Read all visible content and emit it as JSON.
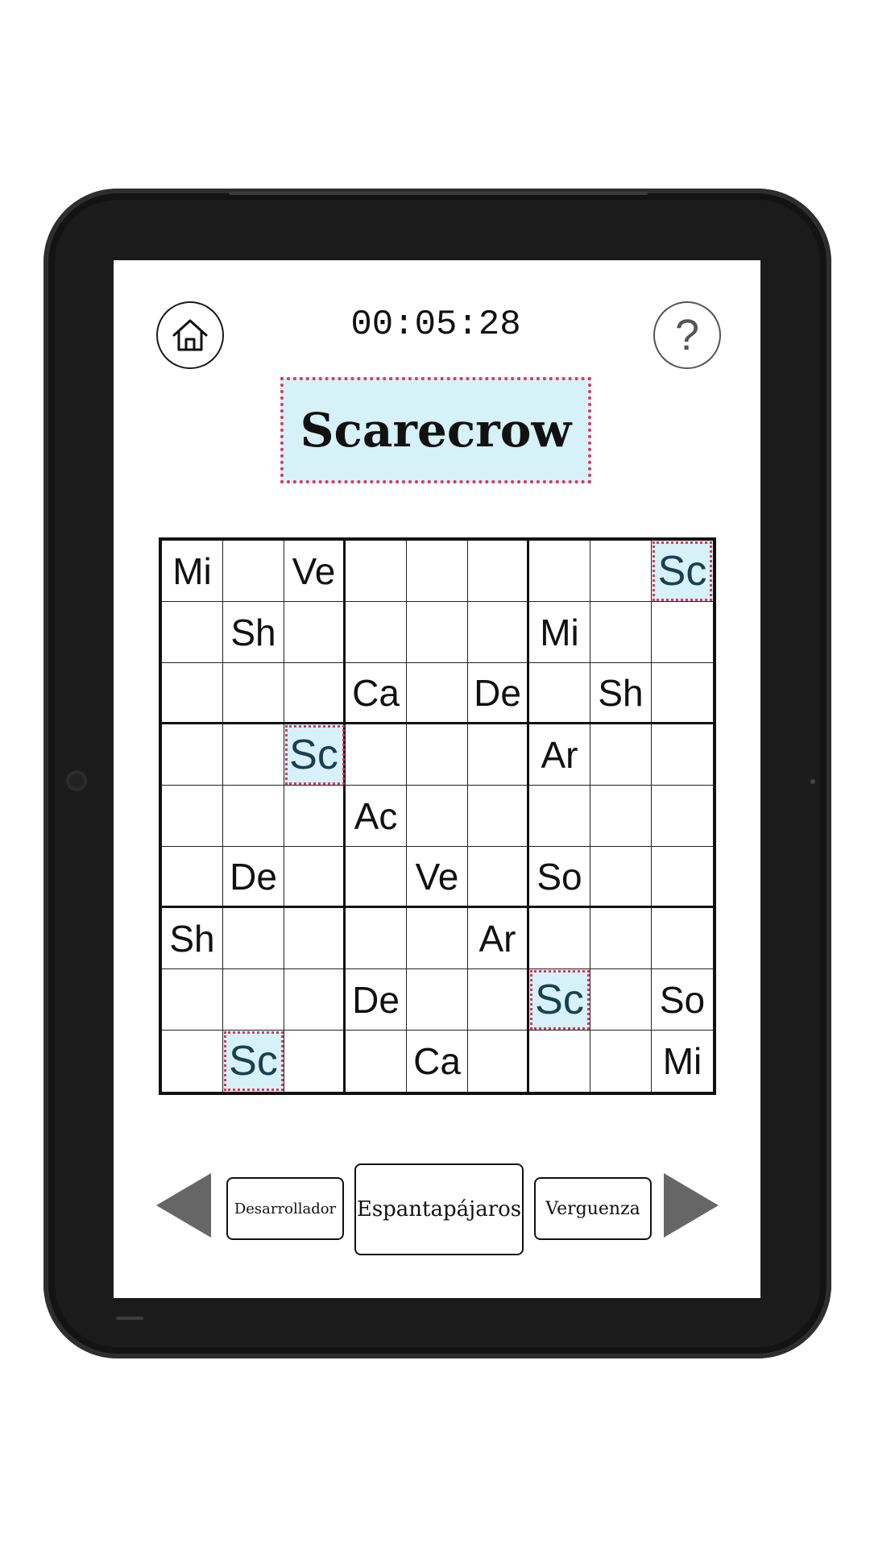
{
  "timer": "00:05:28",
  "help_symbol": "?",
  "icons": {
    "home": "home-icon",
    "help": "question-icon"
  },
  "target_word": "Scarecrow",
  "grid": {
    "rows": [
      [
        "Mi",
        "",
        "Ve",
        "",
        "",
        "",
        "",
        "",
        "Sc"
      ],
      [
        "",
        "Sh",
        "",
        "",
        "",
        "",
        "Mi",
        "",
        ""
      ],
      [
        "",
        "",
        "",
        "Ca",
        "",
        "De",
        "",
        "Sh",
        ""
      ],
      [
        "",
        "",
        "Sc",
        "",
        "",
        "",
        "Ar",
        "",
        ""
      ],
      [
        "",
        "",
        "",
        "Ac",
        "",
        "",
        "",
        "",
        ""
      ],
      [
        "",
        "De",
        "",
        "",
        "Ve",
        "",
        "So",
        "",
        ""
      ],
      [
        "Sh",
        "",
        "",
        "",
        "",
        "Ar",
        "",
        "",
        ""
      ],
      [
        "",
        "",
        "",
        "De",
        "",
        "",
        "Sc",
        "",
        "So"
      ],
      [
        "",
        "Sc",
        "",
        "",
        "Ca",
        "",
        "",
        "",
        "Mi"
      ]
    ],
    "highlighted_value": "Sc"
  },
  "word_choices": {
    "previous_label": "Desarrollador",
    "current_label": "Espantapájaros",
    "next_label": "Verguenza"
  },
  "colors": {
    "highlight_fill": "#d6f1f8",
    "highlight_border": "#e0345a",
    "arrow": "#666666",
    "bezel": "#1b1b1b"
  }
}
